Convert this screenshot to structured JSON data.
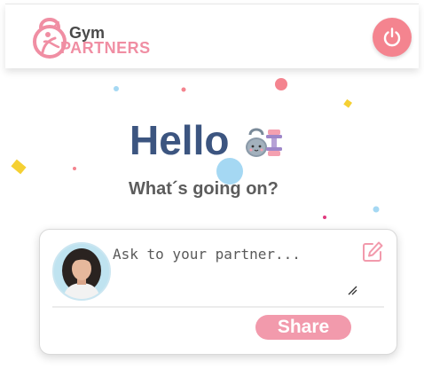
{
  "brand": {
    "name_top": "Gym",
    "name_bottom": "PARTNERS",
    "primary_color": "#f08ea3",
    "text_color": "#4a4a4a"
  },
  "header": {
    "logout_icon": "power-icon",
    "logout_color": "#f4848f"
  },
  "main": {
    "greeting": "Hello",
    "greeting_icon": "dumbbell-kettlebell-icon",
    "subheading": "What´s going on?"
  },
  "post": {
    "placeholder": "Ask to your partner...",
    "value": "",
    "edit_icon": "edit-icon",
    "share_label": "Share",
    "share_color": "#f29aac"
  },
  "decoration": {
    "confetti_colors": [
      "#f4848f",
      "#a5d8f3",
      "#f5d033",
      "#e03a7e"
    ]
  }
}
